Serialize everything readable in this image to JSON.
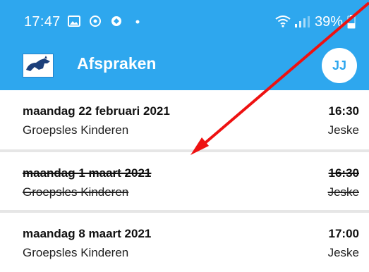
{
  "status_bar": {
    "time": "17:47",
    "battery": "39%",
    "icons": [
      "gallery-icon",
      "chrome-icon",
      "notification-icon",
      "dot-icon",
      "wifi-icon",
      "signal-icon",
      "battery-icon"
    ]
  },
  "app_bar": {
    "title": "Afspraken",
    "avatar_initials": "JJ",
    "logo_icon": "horse-logo-icon"
  },
  "colors": {
    "header": "#2ea7ee",
    "annotation_arrow": "#ee1111",
    "divider": "#e6e6e6"
  },
  "appointments": [
    {
      "date": "maandag 22 februari 2021",
      "lesson": "Groepsles Kinderen",
      "time": "16:30",
      "teacher": "Jeske",
      "cancelled": false
    },
    {
      "date": "maandag 1 maart 2021",
      "lesson": "Groepsles Kinderen",
      "time": "16:30",
      "teacher": "Jeske",
      "cancelled": true
    },
    {
      "date": "maandag 8 maart 2021",
      "lesson": "Groepsles Kinderen",
      "time": "17:00",
      "teacher": "Jeske",
      "cancelled": false
    }
  ]
}
